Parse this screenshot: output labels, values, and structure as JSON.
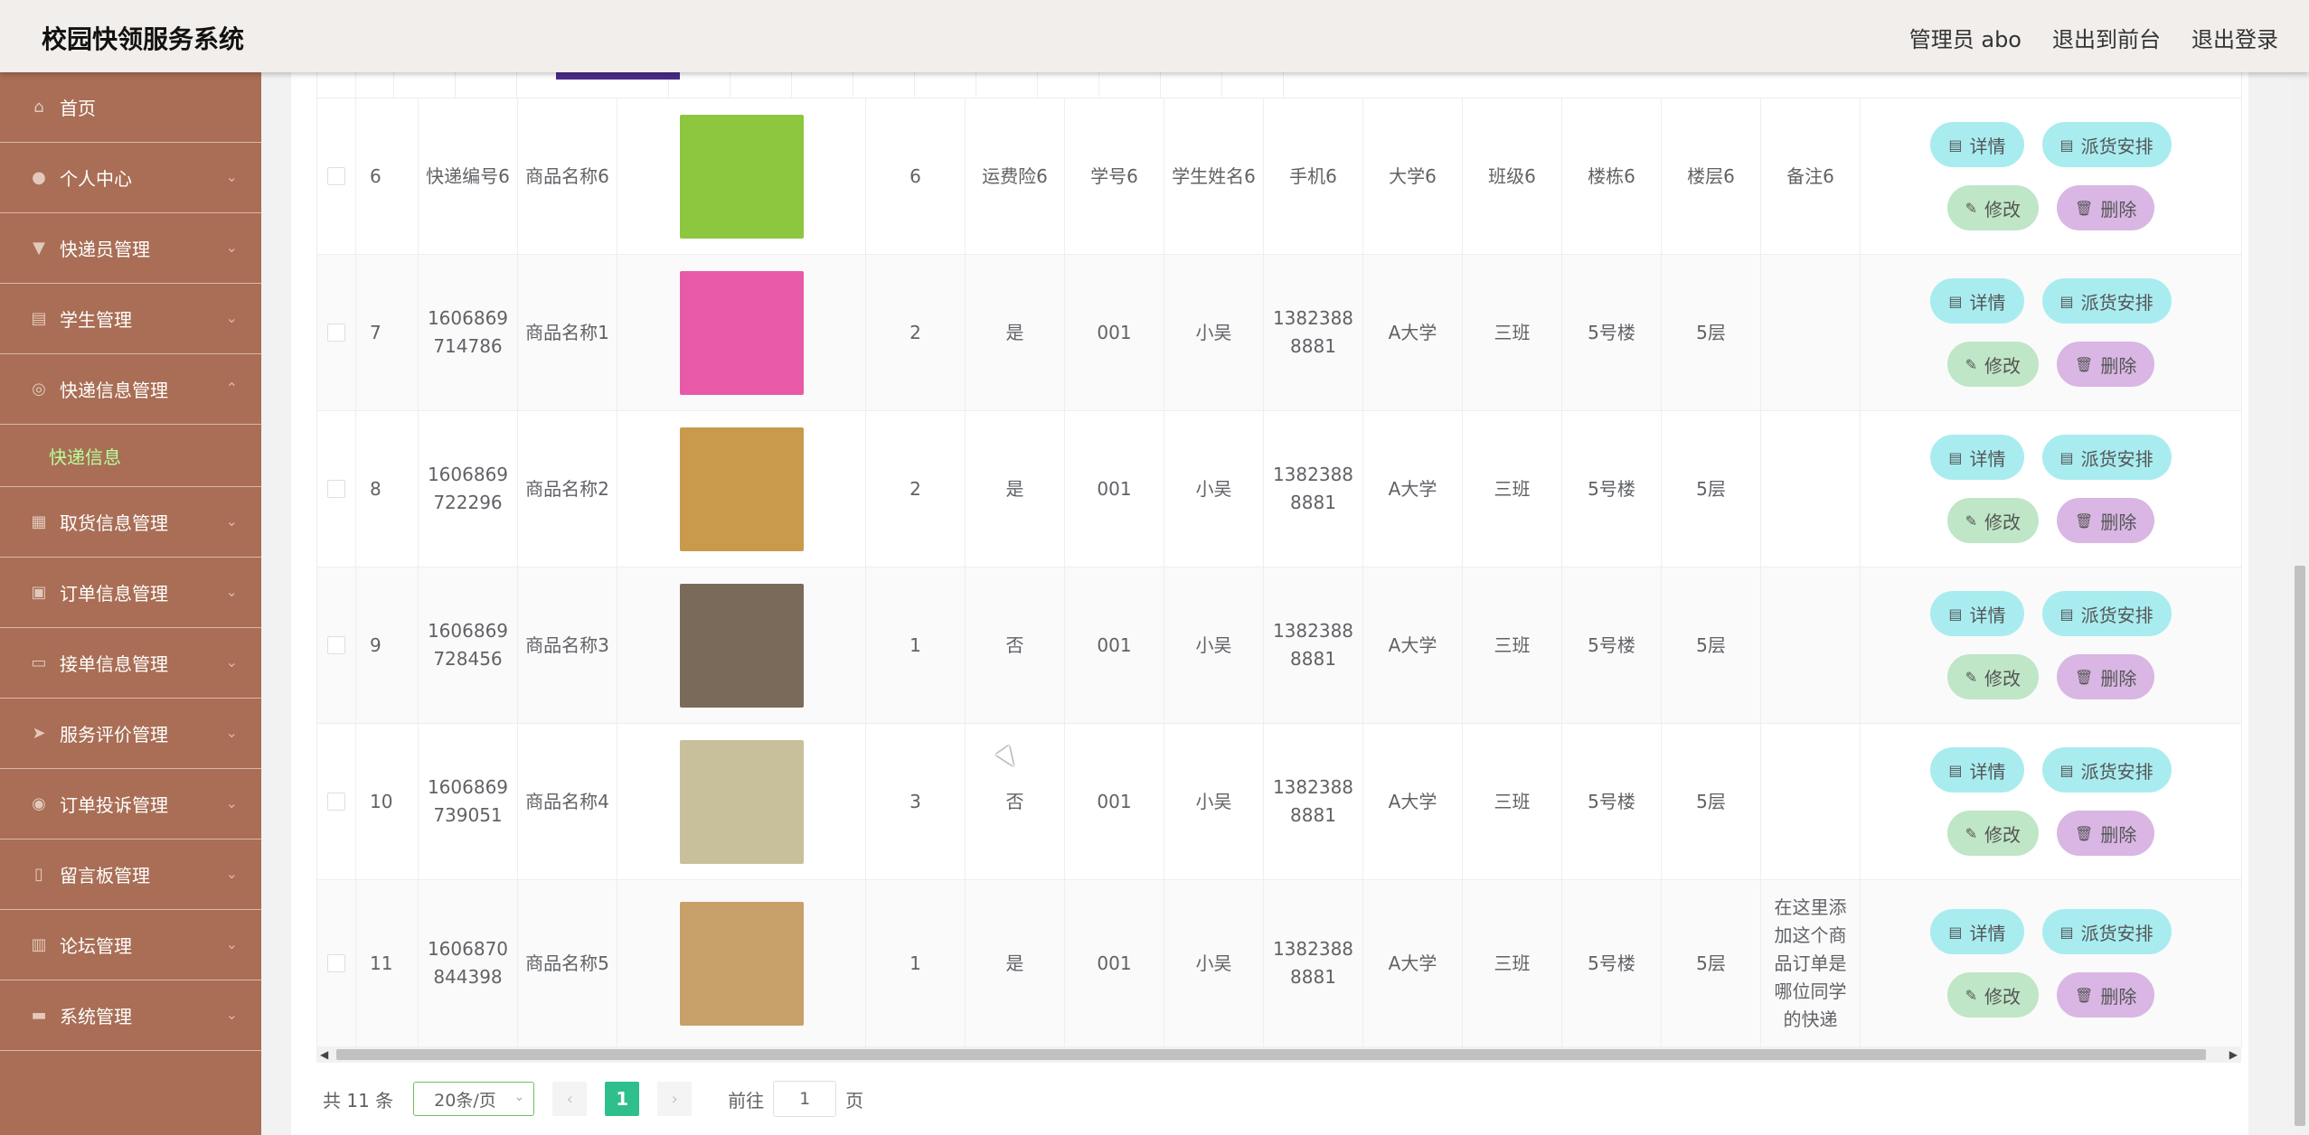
{
  "header": {
    "title": "校园快领服务系统",
    "user": "管理员 abo",
    "front": "退出到前台",
    "logout": "退出登录"
  },
  "sidebar": {
    "items": [
      {
        "label": "首页",
        "icon": "home-icon"
      },
      {
        "label": "个人中心",
        "icon": "user-icon"
      },
      {
        "label": "快递员管理",
        "icon": "courier-icon"
      },
      {
        "label": "学生管理",
        "icon": "clipboard-icon"
      },
      {
        "label": "快递信息管理",
        "icon": "compass-icon",
        "sub": "快递信息"
      },
      {
        "label": "取货信息管理",
        "icon": "box-icon"
      },
      {
        "label": "订单信息管理",
        "icon": "briefcase-icon"
      },
      {
        "label": "接单信息管理",
        "icon": "chat-icon"
      },
      {
        "label": "服务评价管理",
        "icon": "send-icon"
      },
      {
        "label": "订单投诉管理",
        "icon": "target-icon"
      },
      {
        "label": "留言板管理",
        "icon": "phone-icon"
      },
      {
        "label": "论坛管理",
        "icon": "chart-icon"
      },
      {
        "label": "系统管理",
        "icon": "monitor-icon"
      }
    ]
  },
  "buttons": {
    "detail": "详情",
    "dispatch": "派货安排",
    "edit": "修改",
    "delete": "删除"
  },
  "rows": [
    {
      "idx": "6",
      "code": "快递编号6",
      "name": "商品名称6",
      "qty": "6",
      "ins": "运费险6",
      "sid": "学号6",
      "sname": "学生姓名6",
      "phone": "手机6",
      "uni": "大学6",
      "cls": "班级6",
      "bld": "楼栋6",
      "flr": "楼层6",
      "note": "备注6",
      "imgColor": "#8dc63f"
    },
    {
      "idx": "7",
      "code": "1606869714786",
      "name": "商品名称1",
      "qty": "2",
      "ins": "是",
      "sid": "001",
      "sname": "小吴",
      "phone": "13823888881",
      "uni": "A大学",
      "cls": "三班",
      "bld": "5号楼",
      "flr": "5层",
      "note": "",
      "imgColor": "#e85aa8"
    },
    {
      "idx": "8",
      "code": "1606869722296",
      "name": "商品名称2",
      "qty": "2",
      "ins": "是",
      "sid": "001",
      "sname": "小吴",
      "phone": "13823888881",
      "uni": "A大学",
      "cls": "三班",
      "bld": "5号楼",
      "flr": "5层",
      "note": "",
      "imgColor": "#c99a4b"
    },
    {
      "idx": "9",
      "code": "1606869728456",
      "name": "商品名称3",
      "qty": "1",
      "ins": "否",
      "sid": "001",
      "sname": "小吴",
      "phone": "13823888881",
      "uni": "A大学",
      "cls": "三班",
      "bld": "5号楼",
      "flr": "5层",
      "note": "",
      "imgColor": "#7a6a5a"
    },
    {
      "idx": "10",
      "code": "1606869739051",
      "name": "商品名称4",
      "qty": "3",
      "ins": "否",
      "sid": "001",
      "sname": "小吴",
      "phone": "13823888881",
      "uni": "A大学",
      "cls": "三班",
      "bld": "5号楼",
      "flr": "5层",
      "note": "",
      "imgColor": "#c8c09a"
    },
    {
      "idx": "11",
      "code": "1606870844398",
      "name": "商品名称5",
      "qty": "1",
      "ins": "是",
      "sid": "001",
      "sname": "小吴",
      "phone": "13823888881",
      "uni": "A大学",
      "cls": "三班",
      "bld": "5号楼",
      "flr": "5层",
      "note": "在这里添加这个商品订单是哪位同学的快递",
      "imgColor": "#c8a06a"
    }
  ],
  "pager": {
    "total": "共 11 条",
    "size": "20条/页",
    "current": "1",
    "goto_prefix": "前往",
    "goto_value": "1",
    "goto_suffix": "页"
  }
}
